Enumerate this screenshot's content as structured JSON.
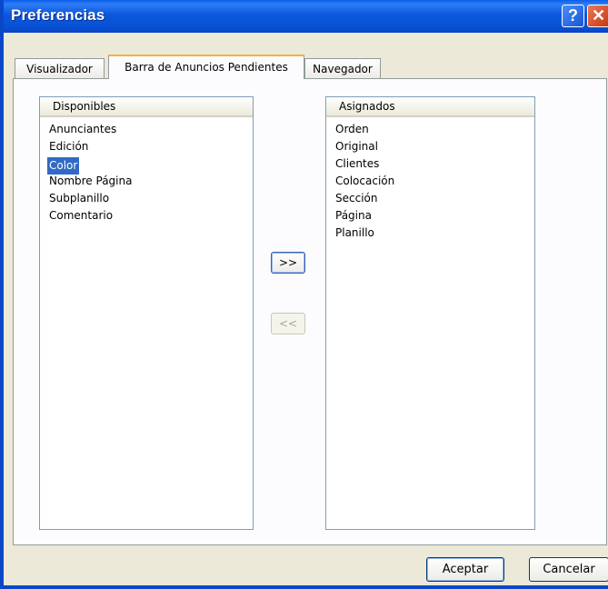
{
  "window": {
    "title": "Preferencias",
    "help_label": "?",
    "close_label": "✕"
  },
  "tabs": [
    {
      "label": "Visualizador",
      "active": false
    },
    {
      "label": "Barra de Anuncios Pendientes",
      "active": true
    },
    {
      "label": "Navegador",
      "active": false
    }
  ],
  "available": {
    "header": "Disponibles",
    "items": [
      "Anunciantes",
      "Edición",
      "Color",
      "Nombre Página",
      "Subplanillo",
      "Comentario"
    ],
    "selected_index": 2
  },
  "assigned": {
    "header": "Asignados",
    "items": [
      "Orden",
      "Original",
      "Clientes",
      "Colocación",
      "Sección",
      "Página",
      "Planillo"
    ]
  },
  "transfer": {
    "add_label": ">>",
    "remove_label": "<<",
    "remove_enabled": false
  },
  "footer": {
    "ok_label": "Aceptar",
    "cancel_label": "Cancelar"
  },
  "colors": {
    "titlebar": "#0b58dc",
    "selection": "#316ac5",
    "accent_tab": "#f0b33c"
  }
}
